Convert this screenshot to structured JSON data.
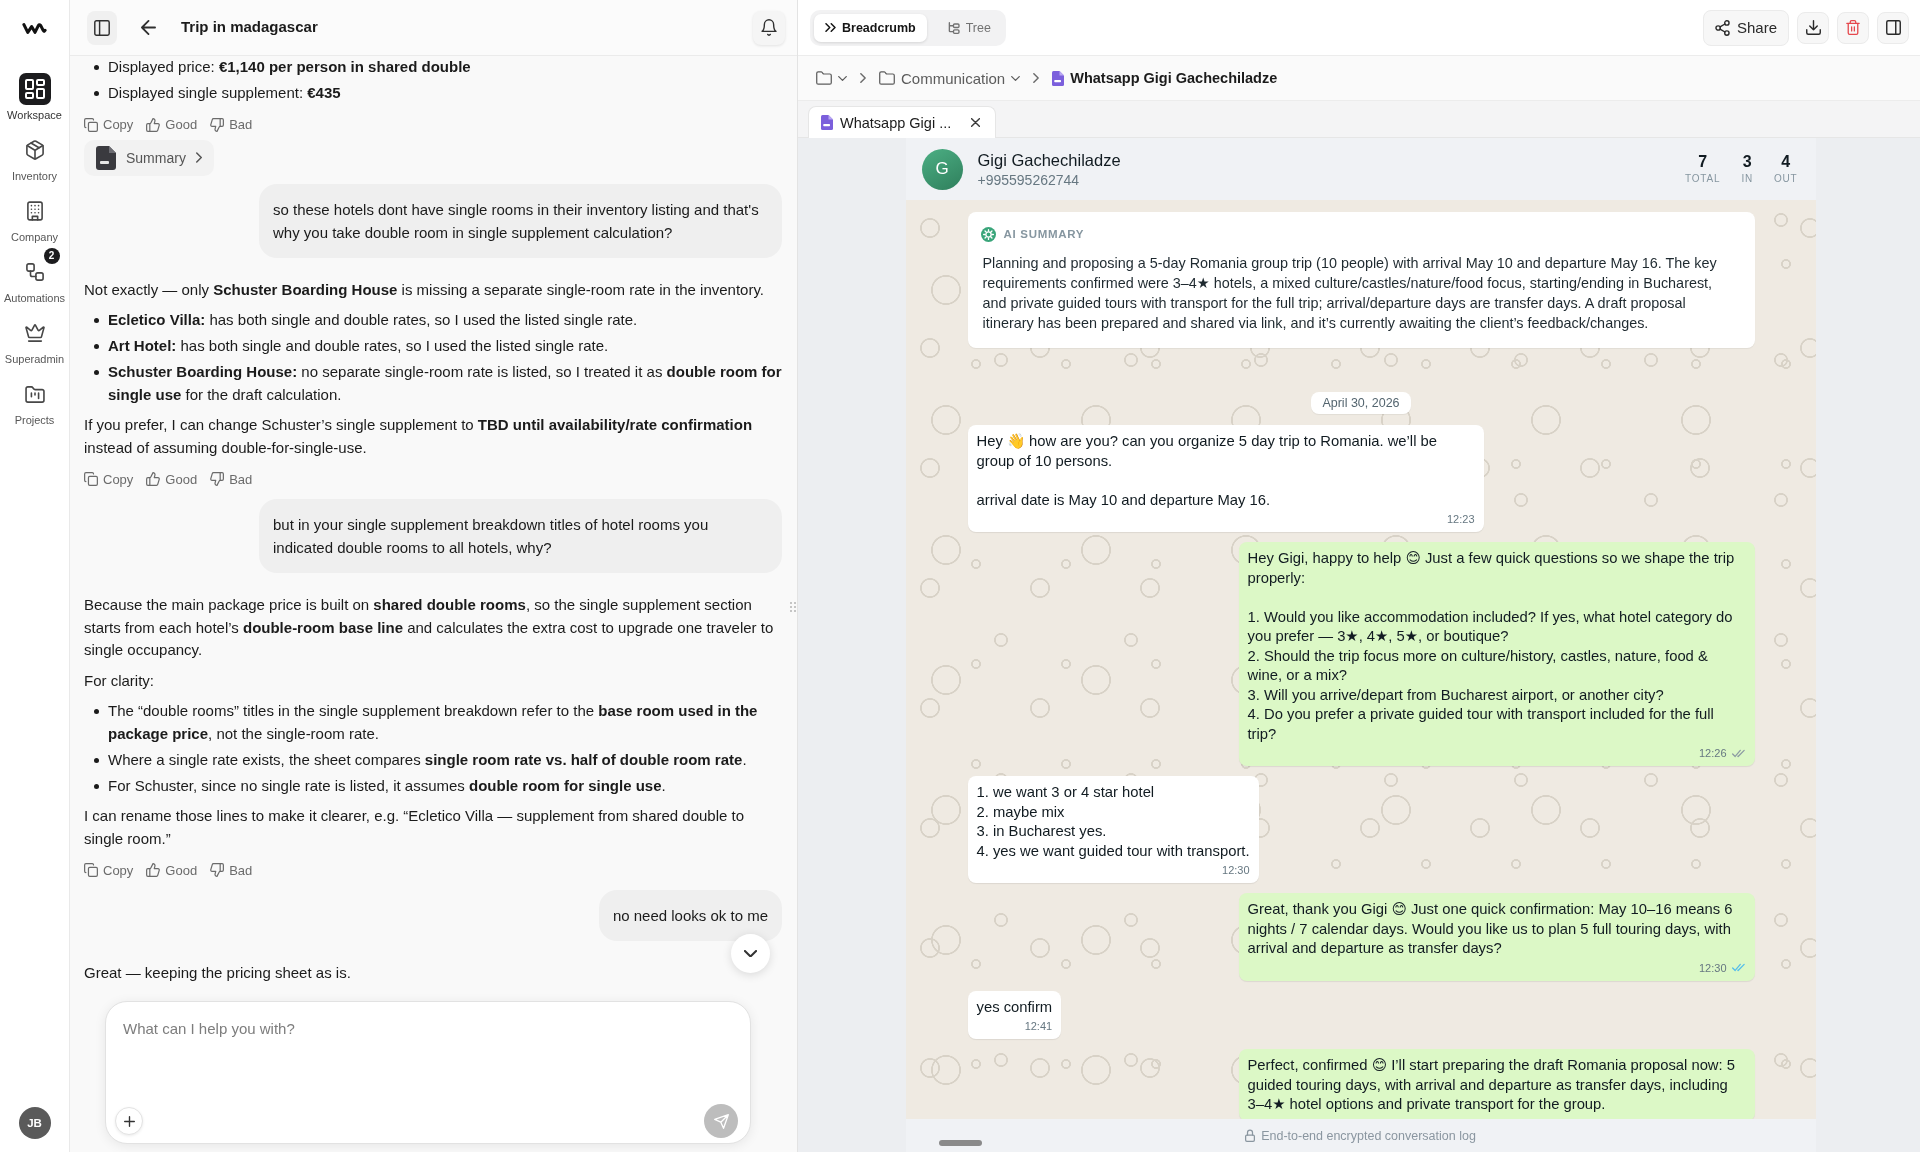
{
  "rail": {
    "items": [
      {
        "label": "Workspace",
        "selected": true
      },
      {
        "label": "Inventory",
        "selected": false
      },
      {
        "label": "Company",
        "selected": false
      },
      {
        "label": "Automations",
        "selected": false,
        "badge": "2"
      },
      {
        "label": "Superadmin",
        "selected": false
      },
      {
        "label": "Projects",
        "selected": false
      }
    ],
    "user": {
      "initials": "JB"
    }
  },
  "chat": {
    "title": "Trip in madagascar",
    "messages": [
      {
        "kind": "assistant",
        "blocks": [
          {
            "kind": "list",
            "items": [
              "Displayed price: **€1,140 per person in shared double**",
              "Displayed single supplement: **€435**"
            ]
          }
        ],
        "actions": [
          {
            "label": "Copy"
          },
          {
            "label": "Good"
          },
          {
            "label": "Bad"
          }
        ],
        "attachment": {
          "label": "Summary"
        }
      },
      {
        "kind": "user",
        "text": "so these hotels dont have single rooms in their inventory listing and that's why you take double room in single supplement calculation?"
      },
      {
        "kind": "assistant",
        "blocks": [
          {
            "kind": "paragraph",
            "text": "Not exactly — only **Schuster Boarding House** is missing a separate single-room rate in the inventory."
          },
          {
            "kind": "list",
            "items": [
              "**Ecletico Villa:** has both single and double rates, so I used the listed single rate.",
              "**Art Hotel:** has both single and double rates, so I used the listed single rate.",
              "**Schuster Boarding House:** no separate single-room rate is listed, so I treated it as **double room for single use** for the draft calculation."
            ]
          },
          {
            "kind": "paragraph",
            "text": "If you prefer, I can change Schuster’s single supplement to **TBD until availability/rate confirmation** instead of assuming double-for-single-use."
          }
        ],
        "actions": [
          {
            "label": "Copy"
          },
          {
            "label": "Good"
          },
          {
            "label": "Bad"
          }
        ]
      },
      {
        "kind": "user",
        "text": "but in your single supplement breakdown titles of hotel rooms you indicated double rooms to all hotels, why?"
      },
      {
        "kind": "assistant",
        "blocks": [
          {
            "kind": "paragraph",
            "text": "Because the main package price is built on **shared double rooms**, so the single supplement section starts from each hotel’s **double-room base line** and calculates the extra cost to upgrade one traveler to single occupancy."
          },
          {
            "kind": "paragraph",
            "text": "For clarity:"
          },
          {
            "kind": "list",
            "items": [
              "The “double rooms” titles in the single supplement breakdown refer to the **base room used in the package price**, not the single-room rate.",
              "Where a single rate exists, the sheet compares **single room rate vs. half of double room rate**.",
              "For Schuster, since no single rate is listed, it assumes **double room for single use**."
            ]
          },
          {
            "kind": "paragraph",
            "text": "I can rename those lines to make it clearer, e.g. “Ecletico Villa — supplement from shared double to single room.”"
          }
        ],
        "actions": [
          {
            "label": "Copy"
          },
          {
            "label": "Good"
          },
          {
            "label": "Bad"
          }
        ]
      },
      {
        "kind": "user",
        "text": "no need looks ok to me"
      },
      {
        "kind": "assistant",
        "blocks": [
          {
            "kind": "paragraph",
            "text": "Great — keeping the pricing sheet as is."
          }
        ]
      }
    ],
    "composer": {
      "placeholder": "What can I help you with?"
    }
  },
  "viewer": {
    "view_modes": [
      {
        "label": "Breadcrumb",
        "selected": true
      },
      {
        "label": "Tree",
        "selected": false
      }
    ],
    "share": {
      "label": "Share"
    },
    "breadcrumb": [
      {
        "kind": "folder",
        "label": "Communication"
      },
      {
        "kind": "file",
        "label": "Whatsapp Gigi Gachechiladze"
      }
    ],
    "tabs": [
      {
        "label": "Whatsapp Gigi ...",
        "selected": true
      }
    ],
    "conversation": {
      "contact": {
        "initial": "G",
        "name": "Gigi Gachechiladze",
        "phone": "+995595262744"
      },
      "stats": [
        {
          "value": "7",
          "label": "TOTAL"
        },
        {
          "value": "3",
          "label": "IN"
        },
        {
          "value": "4",
          "label": "OUT"
        }
      ],
      "summary": {
        "title": "AI SUMMARY",
        "text": "Planning and proposing a 5-day Romania group trip (10 people) with arrival May 10 and departure May 16. The key requirements confirmed were 3–4★ hotels, a mixed culture/castles/nature/food focus, starting/ending in Bucharest, and private guided tours with transport for the full trip; arrival/departure days are transfer days. A draft proposal itinerary has been prepared and shared via link, and it’s currently awaiting the client’s feedback/changes."
      },
      "date": "April 30, 2026",
      "messages": [
        {
          "kind": "incoming",
          "text": "Hey 👋 how are you? can you organize 5 day trip to Romania. we’ll be group of 10 persons.\n\narrival date is May 10 and departure May 16.",
          "time": "12:23"
        },
        {
          "kind": "outgoing",
          "text": "Hey Gigi, happy to help 😊 Just a few quick questions so we shape the trip properly:\n\n1. Would you like accommodation included? If yes, what hotel category do you prefer — 3★, 4★, 5★, or boutique?\n2. Should the trip focus more on culture/history, castles, nature, food & wine, or a mix?\n3. Will you arrive/depart from Bucharest airport, or another city?\n4. Do you prefer a private guided tour with transport included for the full trip?",
          "time": "12:26",
          "read": false
        },
        {
          "kind": "incoming",
          "text": "1. we want 3 or 4 star hotel\n2. maybe mix\n3. in Bucharest yes.\n4. yes we want guided tour with transport.",
          "time": "12:30"
        },
        {
          "kind": "outgoing",
          "text": "Great, thank you Gigi 😊 Just one quick confirmation: May 10–16 means 6 nights / 7 calendar days. Would you like us to plan 5 full touring days, with arrival and departure as transfer days?",
          "time": "12:30",
          "read": true
        },
        {
          "kind": "incoming",
          "text": "yes confirm",
          "time": "12:41"
        },
        {
          "kind": "outgoing",
          "text": "Perfect, confirmed 😊 I’ll start preparing the draft Romania proposal now: 5 guided touring days, with arrival and departure as transfer days, including 3–4★ hotel options and private transport for the group."
        }
      ],
      "footer": "End-to-end encrypted conversation log"
    }
  }
}
